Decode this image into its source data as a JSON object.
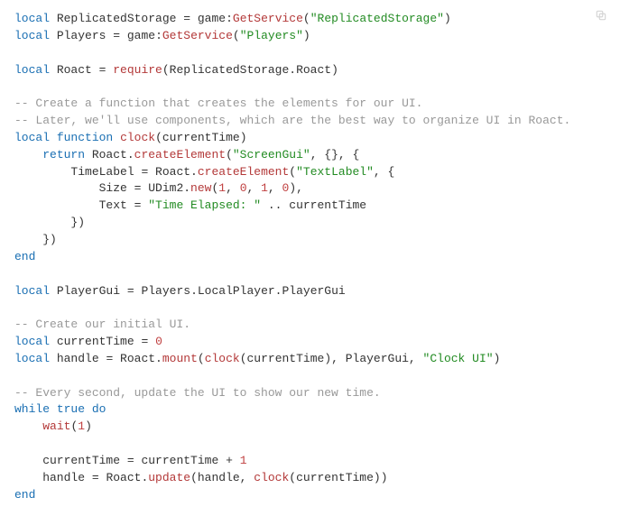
{
  "code": {
    "lines": [
      {
        "t": "code",
        "seg": [
          [
            "kw",
            "local"
          ],
          [
            "id",
            " ReplicatedStorage "
          ],
          [
            "id",
            "="
          ],
          [
            "id",
            " game"
          ],
          [
            "id",
            ":"
          ],
          [
            "fn",
            "GetService"
          ],
          [
            "id",
            "("
          ],
          [
            "str",
            "\"ReplicatedStorage\""
          ],
          [
            "id",
            ")"
          ]
        ]
      },
      {
        "t": "code",
        "seg": [
          [
            "kw",
            "local"
          ],
          [
            "id",
            " Players "
          ],
          [
            "id",
            "="
          ],
          [
            "id",
            " game"
          ],
          [
            "id",
            ":"
          ],
          [
            "fn",
            "GetService"
          ],
          [
            "id",
            "("
          ],
          [
            "str",
            "\"Players\""
          ],
          [
            "id",
            ")"
          ]
        ]
      },
      {
        "t": "blank"
      },
      {
        "t": "code",
        "seg": [
          [
            "kw",
            "local"
          ],
          [
            "id",
            " Roact "
          ],
          [
            "id",
            "="
          ],
          [
            "id",
            " "
          ],
          [
            "fn",
            "require"
          ],
          [
            "id",
            "(ReplicatedStorage.Roact)"
          ]
        ]
      },
      {
        "t": "blank"
      },
      {
        "t": "code",
        "seg": [
          [
            "com",
            "-- Create a function that creates the elements for our UI."
          ]
        ]
      },
      {
        "t": "code",
        "seg": [
          [
            "com",
            "-- Later, we'll use components, which are the best way to organize UI in Roact."
          ]
        ]
      },
      {
        "t": "code",
        "seg": [
          [
            "kw",
            "local"
          ],
          [
            "id",
            " "
          ],
          [
            "kw",
            "function"
          ],
          [
            "id",
            " "
          ],
          [
            "fn",
            "clock"
          ],
          [
            "id",
            "(currentTime)"
          ]
        ]
      },
      {
        "t": "code",
        "seg": [
          [
            "id",
            "    "
          ],
          [
            "kw",
            "return"
          ],
          [
            "id",
            " Roact."
          ],
          [
            "fn",
            "createElement"
          ],
          [
            "id",
            "("
          ],
          [
            "str",
            "\"ScreenGui\""
          ],
          [
            "id",
            ", {}, {"
          ]
        ]
      },
      {
        "t": "code",
        "seg": [
          [
            "id",
            "        TimeLabel "
          ],
          [
            "id",
            "="
          ],
          [
            "id",
            " Roact."
          ],
          [
            "fn",
            "createElement"
          ],
          [
            "id",
            "("
          ],
          [
            "str",
            "\"TextLabel\""
          ],
          [
            "id",
            ", {"
          ]
        ]
      },
      {
        "t": "code",
        "seg": [
          [
            "id",
            "            Size "
          ],
          [
            "id",
            "="
          ],
          [
            "id",
            " UDim2."
          ],
          [
            "fn",
            "new"
          ],
          [
            "id",
            "("
          ],
          [
            "num",
            "1"
          ],
          [
            "id",
            ", "
          ],
          [
            "num",
            "0"
          ],
          [
            "id",
            ", "
          ],
          [
            "num",
            "1"
          ],
          [
            "id",
            ", "
          ],
          [
            "num",
            "0"
          ],
          [
            "id",
            "),"
          ]
        ]
      },
      {
        "t": "code",
        "seg": [
          [
            "id",
            "            Text "
          ],
          [
            "id",
            "="
          ],
          [
            "id",
            " "
          ],
          [
            "str",
            "\"Time Elapsed: \""
          ],
          [
            "id",
            " .. currentTime"
          ]
        ]
      },
      {
        "t": "code",
        "seg": [
          [
            "id",
            "        })"
          ]
        ]
      },
      {
        "t": "code",
        "seg": [
          [
            "id",
            "    })"
          ]
        ]
      },
      {
        "t": "code",
        "seg": [
          [
            "kw",
            "end"
          ]
        ]
      },
      {
        "t": "blank"
      },
      {
        "t": "code",
        "seg": [
          [
            "kw",
            "local"
          ],
          [
            "id",
            " PlayerGui "
          ],
          [
            "id",
            "="
          ],
          [
            "id",
            " Players.LocalPlayer.PlayerGui"
          ]
        ]
      },
      {
        "t": "blank"
      },
      {
        "t": "code",
        "seg": [
          [
            "com",
            "-- Create our initial UI."
          ]
        ]
      },
      {
        "t": "code",
        "seg": [
          [
            "kw",
            "local"
          ],
          [
            "id",
            " currentTime "
          ],
          [
            "id",
            "="
          ],
          [
            "id",
            " "
          ],
          [
            "num",
            "0"
          ]
        ]
      },
      {
        "t": "code",
        "seg": [
          [
            "kw",
            "local"
          ],
          [
            "id",
            " handle "
          ],
          [
            "id",
            "="
          ],
          [
            "id",
            " Roact."
          ],
          [
            "fn",
            "mount"
          ],
          [
            "id",
            "("
          ],
          [
            "fn",
            "clock"
          ],
          [
            "id",
            "(currentTime), PlayerGui, "
          ],
          [
            "str",
            "\"Clock UI\""
          ],
          [
            "id",
            ")"
          ]
        ]
      },
      {
        "t": "blank"
      },
      {
        "t": "code",
        "seg": [
          [
            "com",
            "-- Every second, update the UI to show our new time."
          ]
        ]
      },
      {
        "t": "code",
        "seg": [
          [
            "kw",
            "while"
          ],
          [
            "id",
            " "
          ],
          [
            "bool",
            "true"
          ],
          [
            "id",
            " "
          ],
          [
            "kw",
            "do"
          ]
        ]
      },
      {
        "t": "code",
        "seg": [
          [
            "id",
            "    "
          ],
          [
            "fn",
            "wait"
          ],
          [
            "id",
            "("
          ],
          [
            "num",
            "1"
          ],
          [
            "id",
            ")"
          ]
        ]
      },
      {
        "t": "blank"
      },
      {
        "t": "code",
        "seg": [
          [
            "id",
            "    currentTime "
          ],
          [
            "id",
            "="
          ],
          [
            "id",
            " currentTime "
          ],
          [
            "id",
            "+"
          ],
          [
            "id",
            " "
          ],
          [
            "num",
            "1"
          ]
        ]
      },
      {
        "t": "code",
        "seg": [
          [
            "id",
            "    handle "
          ],
          [
            "id",
            "="
          ],
          [
            "id",
            " Roact."
          ],
          [
            "fn",
            "update"
          ],
          [
            "id",
            "(handle, "
          ],
          [
            "fn",
            "clock"
          ],
          [
            "id",
            "(currentTime))"
          ]
        ]
      },
      {
        "t": "code",
        "seg": [
          [
            "kw",
            "end"
          ]
        ]
      }
    ]
  },
  "copy_button": {
    "label": "copy"
  }
}
